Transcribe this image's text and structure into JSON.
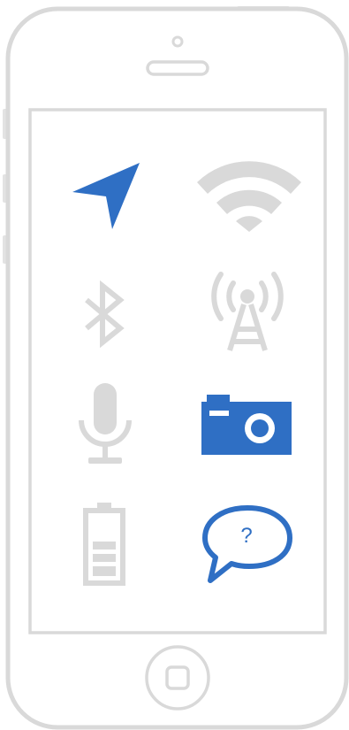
{
  "colors": {
    "accent": "#2f6fc4",
    "inactive": "#d9d9d9",
    "frame": "#d9d9d9"
  },
  "device": {
    "name": "phone-mockup",
    "screen": {
      "icons": [
        {
          "name": "location-arrow-icon",
          "state": "active"
        },
        {
          "name": "wifi-icon",
          "state": "inactive"
        },
        {
          "name": "bluetooth-icon",
          "state": "inactive"
        },
        {
          "name": "cell-tower-icon",
          "state": "inactive"
        },
        {
          "name": "microphone-icon",
          "state": "inactive"
        },
        {
          "name": "camera-icon",
          "state": "active"
        },
        {
          "name": "battery-icon",
          "state": "inactive"
        },
        {
          "name": "help-bubble-icon",
          "state": "active"
        }
      ]
    }
  },
  "help_bubble": {
    "glyph": "?"
  }
}
